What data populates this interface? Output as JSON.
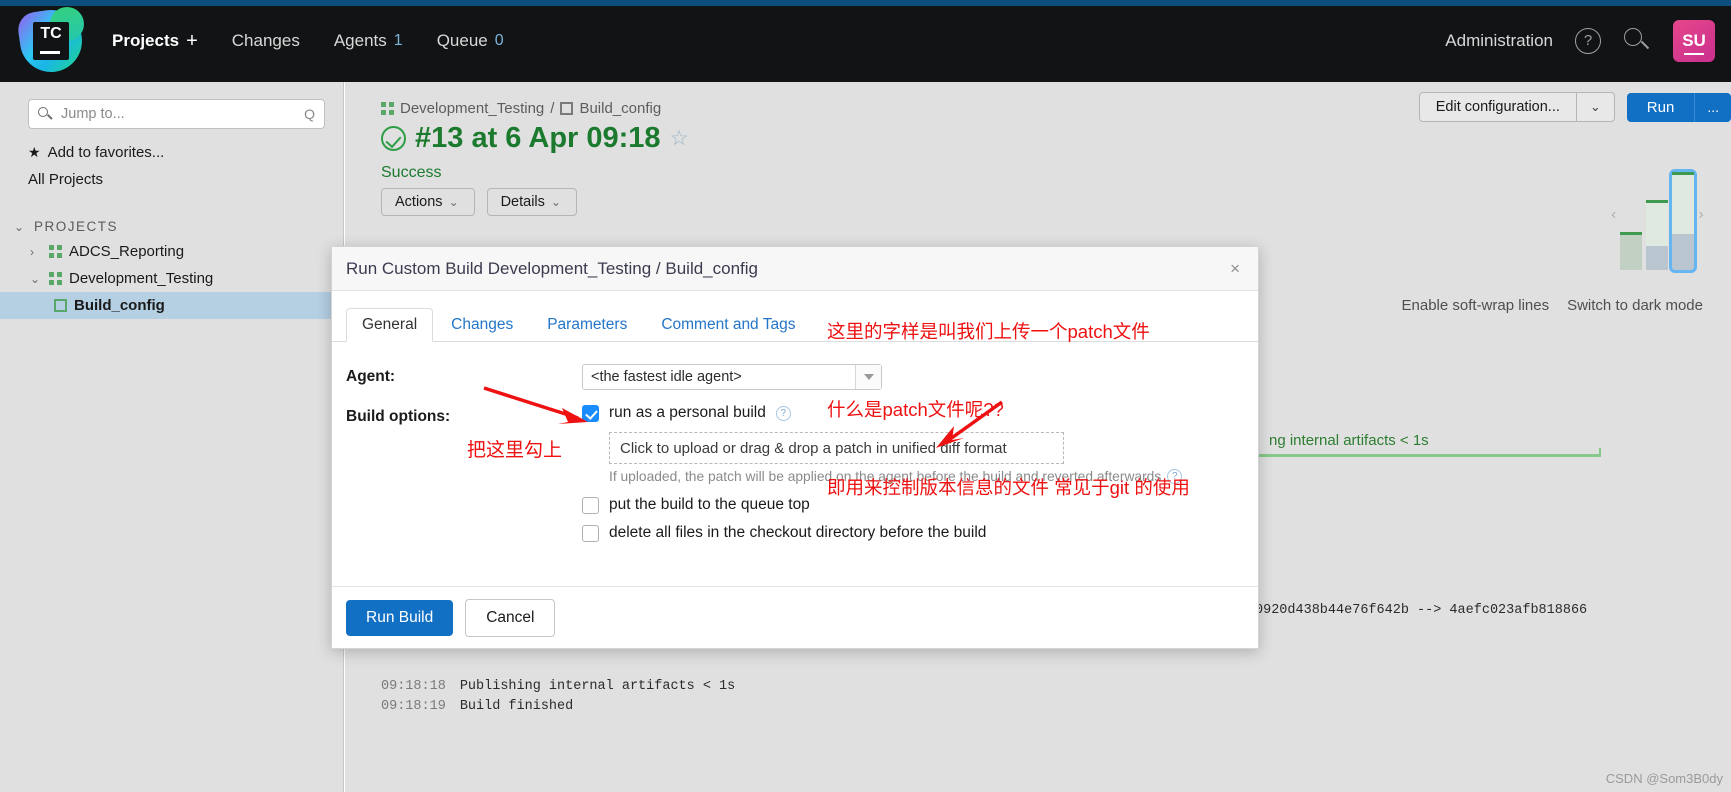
{
  "header": {
    "logo_text": "TC",
    "nav": [
      {
        "label": "Projects",
        "plus": "+",
        "count": ""
      },
      {
        "label": "Changes",
        "plus": "",
        "count": ""
      },
      {
        "label": "Agents",
        "plus": "",
        "count": "1"
      },
      {
        "label": "Queue",
        "plus": "",
        "count": "0"
      }
    ],
    "administration": "Administration",
    "help_icon": "?",
    "search_icon": "search-icon",
    "avatar_initials": "SU"
  },
  "sidebar": {
    "search_placeholder": "Jump to...",
    "search_value": "",
    "search_hint": "Q",
    "add_favorites": "Add to favorites...",
    "all_projects": "All Projects",
    "projects_header": "PROJECTS",
    "tree": [
      {
        "label": "ADCS_Reporting",
        "type": "project",
        "expanded": false,
        "selected": false
      },
      {
        "label": "Development_Testing",
        "type": "project",
        "expanded": true,
        "selected": false
      },
      {
        "label": "Build_config",
        "type": "config",
        "expanded": false,
        "selected": true
      }
    ]
  },
  "main": {
    "breadcrumb_project": "Development_Testing",
    "breadcrumb_sep": "/",
    "breadcrumb_config": "Build_config",
    "build_title": "#13 at 6 Apr 09:18",
    "status": "Success",
    "actions_button": "Actions",
    "details_button": "Details",
    "edit_configuration": "Edit configuration...",
    "run_button": "Run",
    "run_more": "...",
    "log_toolbar": [
      "Enable soft-wrap lines",
      "Switch to dark mode"
    ],
    "log_partial_line": "ng internal artifacts < 1s",
    "log_hash_line": "0920d438b44e76f642b --> 4aefc023afb818866",
    "log_lines": [
      {
        "ts": "09:18:18",
        "text": "Publishing internal artifacts < 1s"
      },
      {
        "ts": "09:18:19",
        "text": "Build finished"
      }
    ]
  },
  "dialog": {
    "title": "Run Custom Build Development_Testing / Build_config",
    "close_icon": "×",
    "tabs": [
      {
        "label": "General",
        "active": true
      },
      {
        "label": "Changes",
        "active": false
      },
      {
        "label": "Parameters",
        "active": false
      },
      {
        "label": "Comment and Tags",
        "active": false
      }
    ],
    "agent_label": "Agent:",
    "agent_value": "<the fastest idle agent>",
    "build_options_label": "Build options:",
    "personal_build_label": "run as a personal build",
    "personal_build_checked": true,
    "personal_build_help": "?",
    "dropzone_text": "Click to upload or drag & drop a patch in unified diff format",
    "hint_text": "If uploaded, the patch will be applied on the agent before the build and reverted afterwards",
    "hint_help": "?",
    "queue_top_label": "put the build to the queue top",
    "queue_top_checked": false,
    "delete_files_label": "delete all files in the checkout directory before the build",
    "delete_files_checked": false,
    "run_build_button": "Run Build",
    "cancel_button": "Cancel"
  },
  "annotations": {
    "note_right_line1": "这里的字样是叫我们上传一个patch文件",
    "note_right_line2": "什么是patch文件呢??",
    "note_right_line3": "即用来控制版本信息的文件 常见于git 的使用",
    "note_checkbox": "把这里勾上"
  },
  "watermark": "CSDN @Som3B0dy",
  "colors": {
    "accent_blue": "#1270c4",
    "header_bg": "#111314",
    "success_green": "#1b7a2e",
    "annotation_red": "#ee1111",
    "selected_row": "#b5cfe3"
  }
}
